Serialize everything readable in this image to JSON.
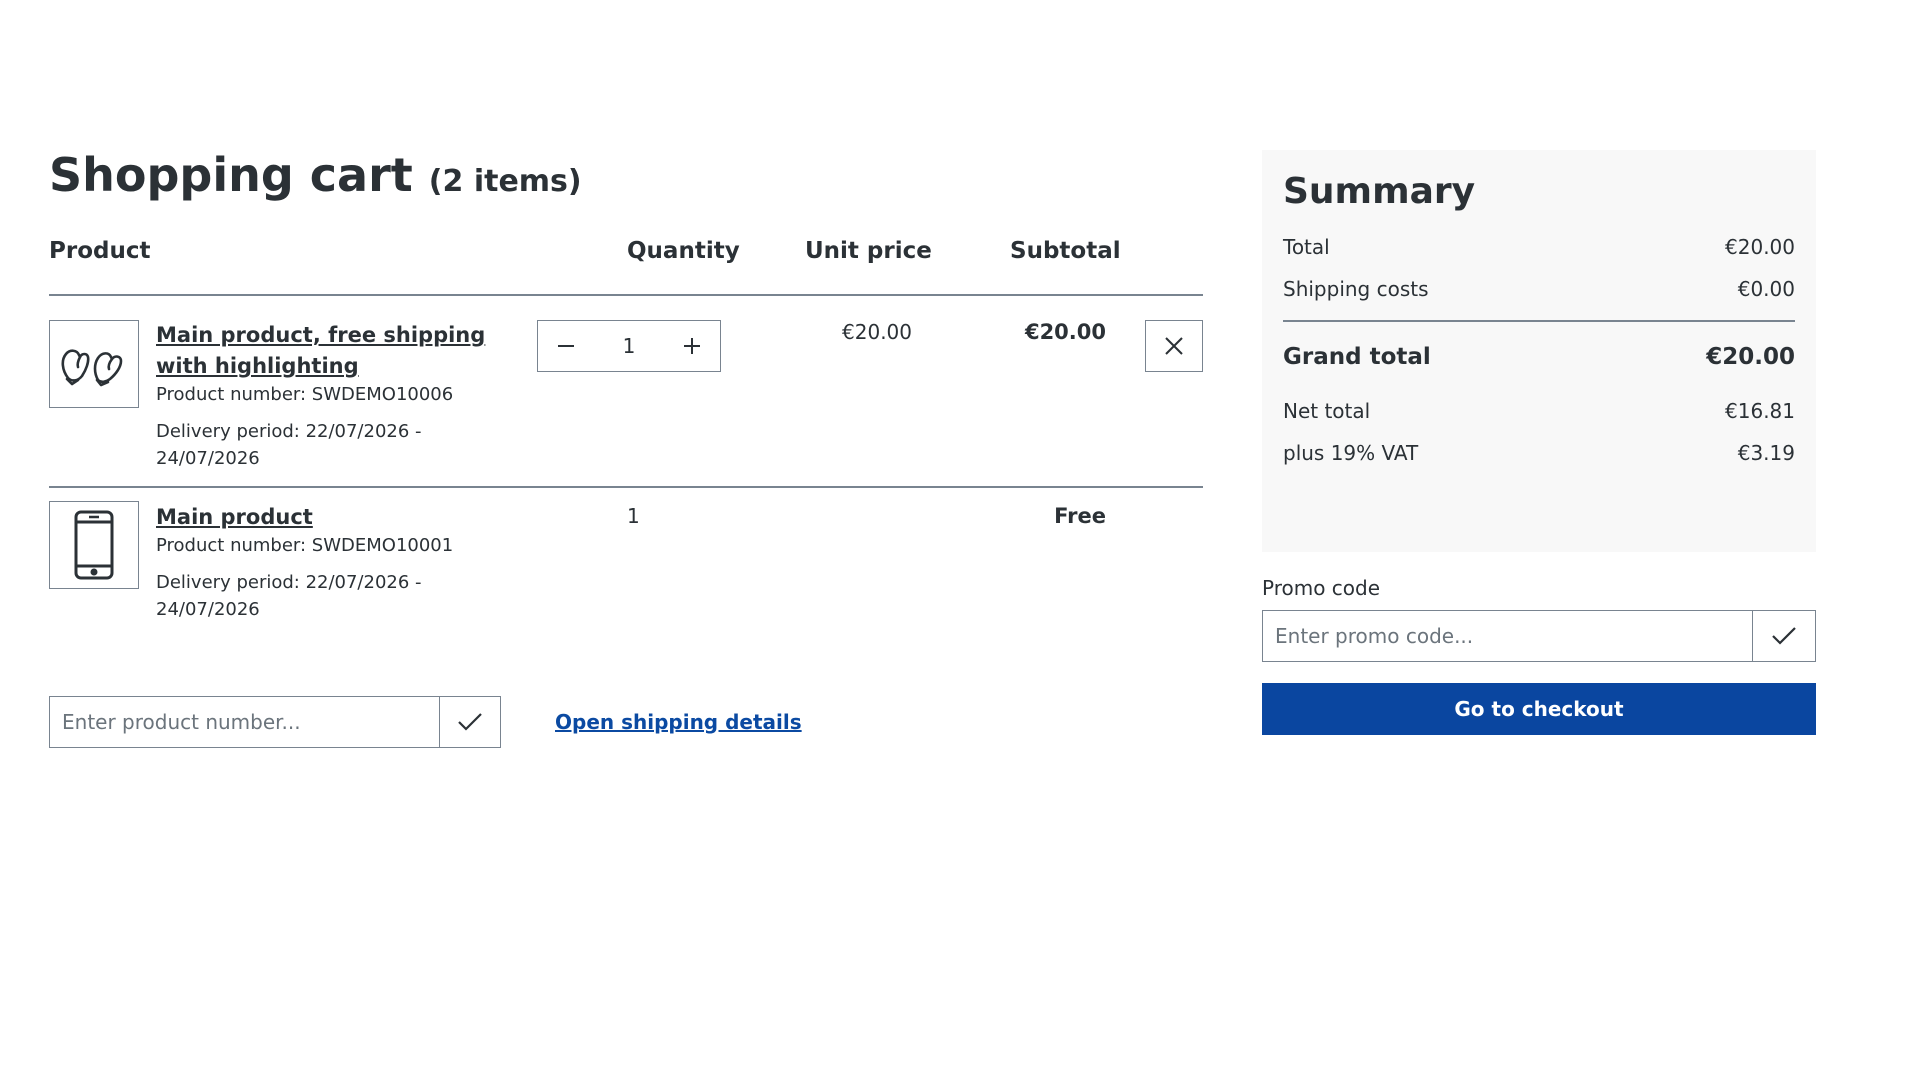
{
  "cart": {
    "title": "Shopping cart",
    "item_count": "(2 items)",
    "columns": {
      "product": "Product",
      "quantity": "Quantity",
      "unit_price": "Unit price",
      "subtotal": "Subtotal"
    },
    "items": [
      {
        "name": "Main product, free shipping with highlighting",
        "product_number": "Product number: SWDEMO10006",
        "delivery": "Delivery period: 22/07/2026 - 24/07/2026",
        "quantity": "1",
        "unit_price": "€20.00",
        "subtotal": "€20.00",
        "icon": "mittens-icon"
      },
      {
        "name": "Main product",
        "product_number": "Product number: SWDEMO10001",
        "delivery": "Delivery period: 22/07/2026 - 24/07/2026",
        "quantity": "1",
        "subtotal": "Free",
        "icon": "smartphone-icon"
      }
    ],
    "add_product_placeholder": "Enter product number...",
    "shipping_link": "Open shipping details"
  },
  "summary": {
    "title": "Summary",
    "total_label": "Total",
    "total_value": "€20.00",
    "shipping_label": "Shipping costs",
    "shipping_value": "€0.00",
    "grand_label": "Grand total",
    "grand_value": "€20.00",
    "net_label": "Net total",
    "net_value": "€16.81",
    "vat_label": "plus 19% VAT",
    "vat_value": "€3.19",
    "promo_label": "Promo code",
    "promo_placeholder": "Enter promo code...",
    "checkout_label": "Go to checkout"
  },
  "colors": {
    "primary": "#0a46a0",
    "link": "#0b4aa2",
    "text": "#2b3136",
    "border": "#798490",
    "summary_bg": "#f8f8f8"
  }
}
